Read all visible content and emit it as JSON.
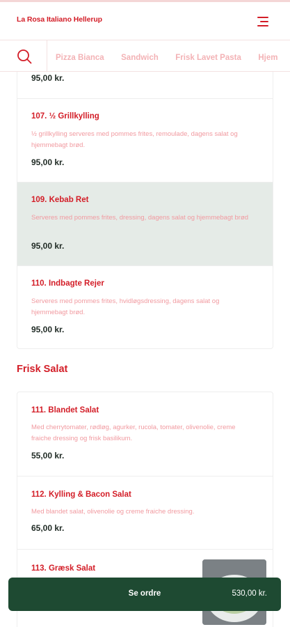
{
  "header": {
    "brand": "La Rosa Italiano Hellerup",
    "menu_icon": "hamburger-menu-icon"
  },
  "category_bar": {
    "search_icon": "search-icon",
    "items": [
      "Pizza Bianca",
      "Sandwich",
      "Frisk Lavet Pasta",
      "Hjem"
    ]
  },
  "sections": [
    {
      "items": [
        {
          "price": "95,00 kr."
        },
        {
          "name": "107. ½ Grillkylling",
          "description": "½ grillkylling serveres med pommes frites, remoulade, dagens salat og hjemmebagt brød.",
          "price": "95,00 kr."
        },
        {
          "name": "109. Kebab Ret",
          "description": "Serveres med pommes frites, dressing, dagens salat og hjemmebagt brød",
          "price": "95,00 kr."
        },
        {
          "name": "110. Indbagte Rejer",
          "description": "Serveres med pommes frites, hvidløgsdressing, dagens salat og hjemmebagt brød.",
          "price": "95,00 kr."
        }
      ]
    },
    {
      "title": "Frisk Salat",
      "items": [
        {
          "name": "111. Blandet Salat",
          "description": "Med cherrytomater, rødløg, agurker, rucola, tomater, olivenolie, creme fraiche dressing og frisk basilikum.",
          "price": "55,00 kr."
        },
        {
          "name": "112. Kylling & Bacon Salat",
          "description": "Med blandet salat, olivenolie og creme fraiche dressing.",
          "price": "65,00 kr."
        },
        {
          "name": "113. Græsk Salat"
        }
      ]
    }
  ],
  "order_bar": {
    "label": "Se ordre",
    "total": "530,00 kr."
  },
  "colors": {
    "brand_red": "#d31d27",
    "muted_pink": "#f19aa0",
    "highlight_green": "#e5ebe7",
    "order_green": "#1e4a32"
  }
}
